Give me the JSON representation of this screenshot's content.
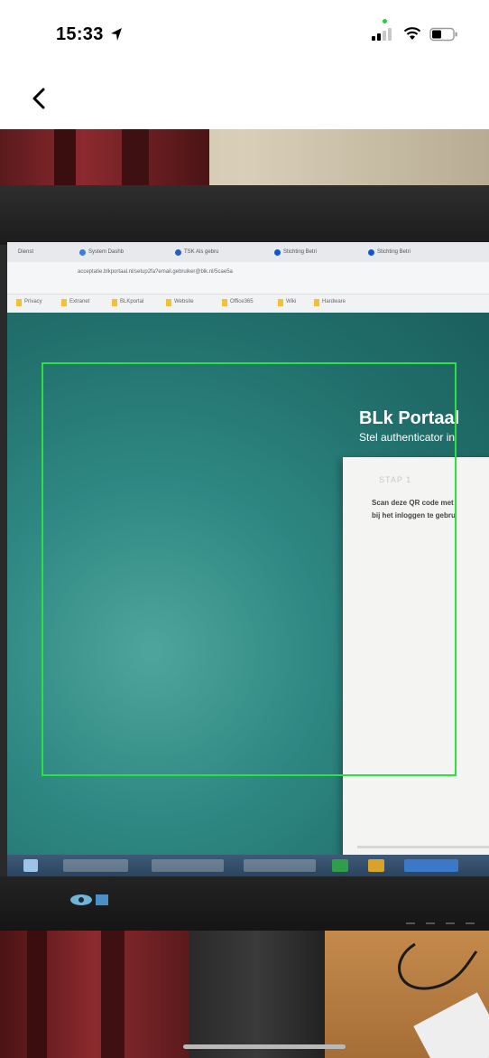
{
  "status_bar": {
    "time": "15:33",
    "icons": [
      "location-arrow-icon",
      "cellular-signal-icon",
      "wifi-icon",
      "battery-icon"
    ],
    "indicator_color": "#2ec84a"
  },
  "nav": {
    "back_icon": "chevron-left-icon"
  },
  "camera": {
    "browser_tabs": [
      "Dienst",
      "System Dashb",
      "TSK Als gebru",
      "Stichting Betri",
      "Stichting Betri"
    ],
    "address_url": "acceptatie.blkportaal.nl/setup2fa?email.gebruiker@blk.nl/5cae5a",
    "bookmarks": [
      "Privacy",
      "Extranet",
      "BLKportal",
      "Website",
      "Office365",
      "Wiki",
      "Hardware"
    ],
    "portal_title": "BLk Portaal",
    "portal_subtitle": "Stel authenticator in",
    "card": {
      "step": "STAP 1",
      "line1": "Scan deze QR code met",
      "line2": "bij het inloggen te gebru"
    },
    "scan_frame_color": "#2de23e"
  }
}
